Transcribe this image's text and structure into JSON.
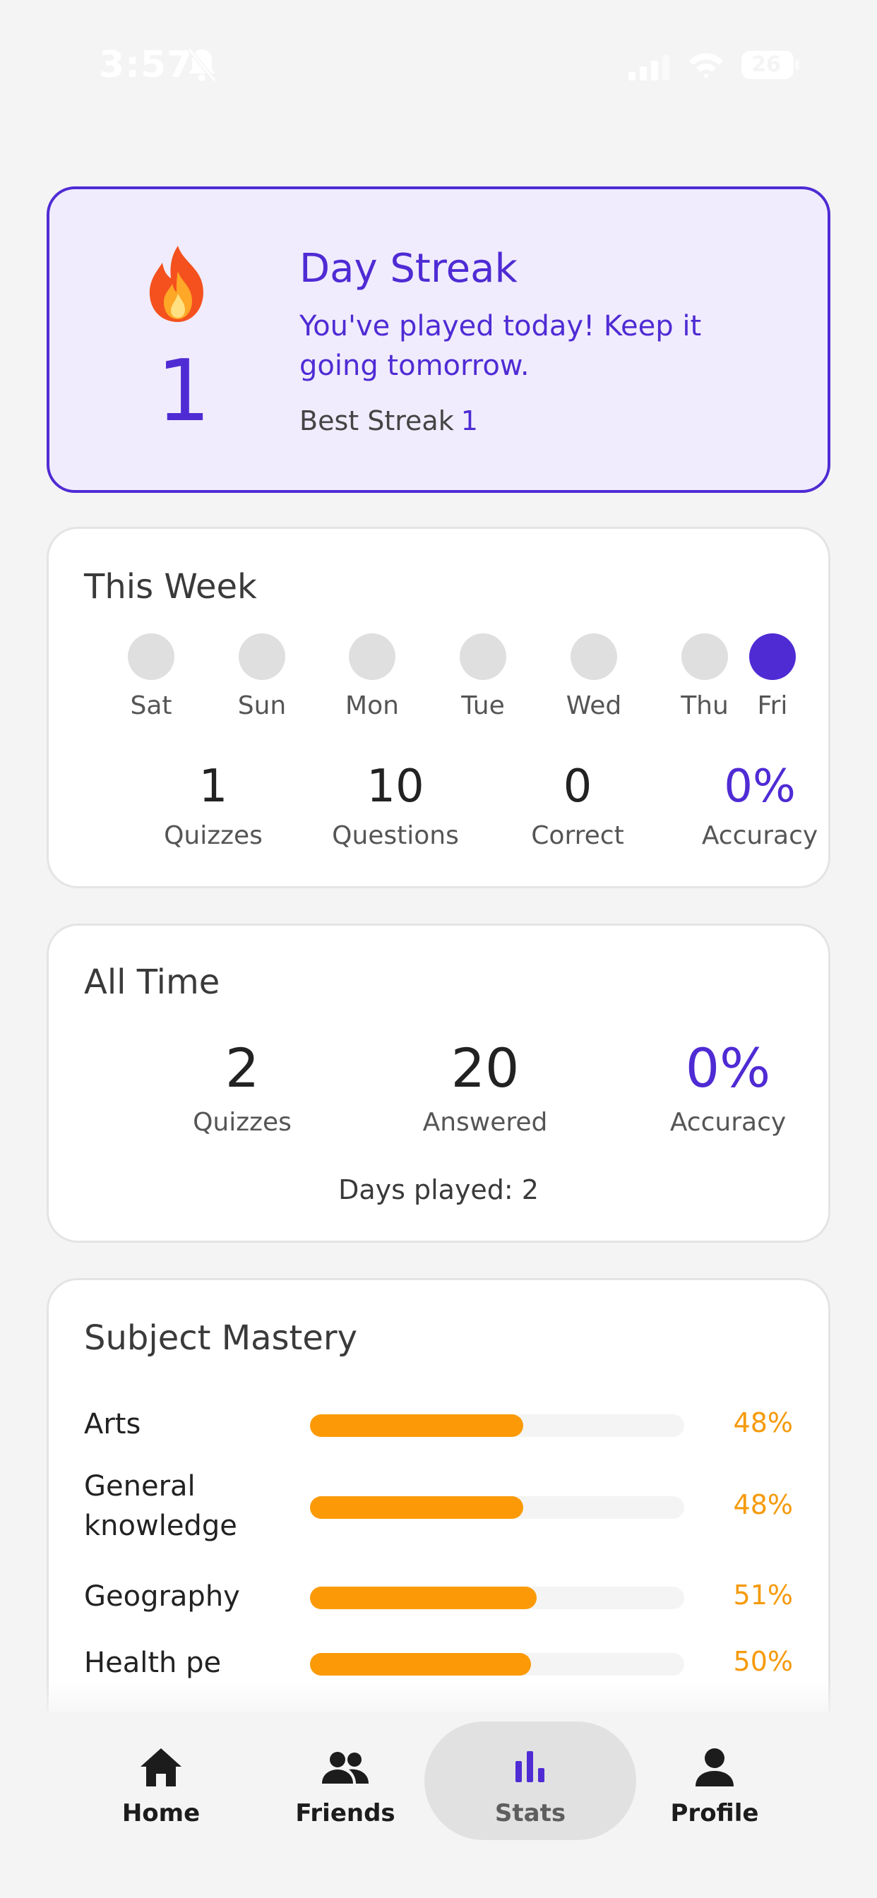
{
  "status_bar": {
    "time": "3:57",
    "battery": "26",
    "icons": [
      "bell-muted-icon",
      "signal-icon",
      "wifi-icon",
      "battery-icon"
    ]
  },
  "streak": {
    "icon": "fire-icon",
    "count": "1",
    "title": "Day Streak",
    "message": "You've played today! Keep it going tomorrow.",
    "best_label": "Best Streak",
    "best_value": "1"
  },
  "this_week": {
    "title": "This Week",
    "days": [
      {
        "label": "Sat",
        "played": false
      },
      {
        "label": "Sun",
        "played": false
      },
      {
        "label": "Mon",
        "played": false
      },
      {
        "label": "Tue",
        "played": false
      },
      {
        "label": "Wed",
        "played": false
      },
      {
        "label": "Thu",
        "played": false
      },
      {
        "label": "Fri",
        "played": true
      }
    ],
    "stats": [
      {
        "value": "1",
        "label": "Quizzes"
      },
      {
        "value": "10",
        "label": "Questions"
      },
      {
        "value": "0",
        "label": "Correct"
      },
      {
        "value": "0%",
        "label": "Accuracy"
      }
    ]
  },
  "all_time": {
    "title": "All Time",
    "stats": [
      {
        "value": "2",
        "label": "Quizzes"
      },
      {
        "value": "20",
        "label": "Answered"
      },
      {
        "value": "0%",
        "label": "Accuracy"
      }
    ],
    "days_played_label": "Days played:",
    "days_played_value": "2"
  },
  "subject_mastery": {
    "title": "Subject Mastery",
    "subjects": [
      {
        "name": "Arts",
        "percent_label": "48%",
        "fraction": 0.57
      },
      {
        "name": "General knowledge",
        "percent_label": "48%",
        "fraction": 0.57
      },
      {
        "name": "Geography",
        "percent_label": "51%",
        "fraction": 0.605
      },
      {
        "name": "Health pe",
        "percent_label": "50%",
        "fraction": 0.59
      }
    ]
  },
  "bottom_nav": {
    "items": [
      {
        "label": "Home",
        "icon": "home-icon",
        "active": false
      },
      {
        "label": "Friends",
        "icon": "people-icon",
        "active": false
      },
      {
        "label": "Stats",
        "icon": "bar-chart-icon",
        "active": true
      },
      {
        "label": "Profile",
        "icon": "person-icon",
        "active": false
      }
    ]
  },
  "colors": {
    "accent": "#4f2bd4",
    "streak_bg": "#f0ecfd",
    "progress": "#fb9a06",
    "inactive_dot": "#dfdfdf"
  }
}
